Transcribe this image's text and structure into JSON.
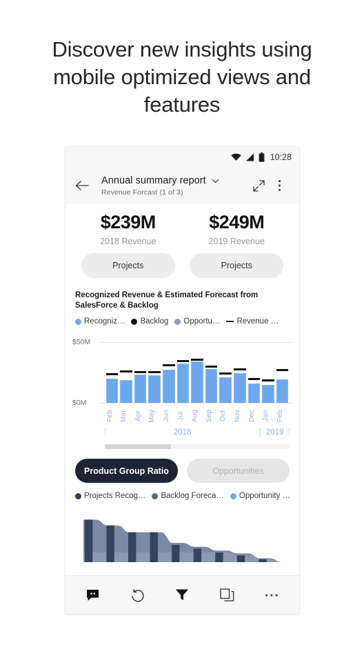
{
  "headline": "Discover new insights using mobile optimized views and features",
  "statusbar": {
    "time": "10:28",
    "icons": [
      "wifi-icon",
      "cellular-signal-icon",
      "battery-icon"
    ]
  },
  "appbar": {
    "back_icon": "back-arrow-icon",
    "title": "Annual summary report",
    "title_chevron_icon": "chevron-down-icon",
    "subtitle": "Revenue Forcast  (1 of 3)",
    "expand_icon": "expand-diagonal-icon",
    "more_icon": "more-vertical-icon"
  },
  "kpis": [
    {
      "value": "$239M",
      "label": "2018 Revenue",
      "button": "Projects"
    },
    {
      "value": "$249M",
      "label": "2019 Revenue",
      "button": "Projects"
    }
  ],
  "chart": {
    "title": "Recognized Revenue & Estimated Forecast from SalesForce & Backlog",
    "legend": [
      {
        "label": "Recogniz…",
        "color": "#6ea8ec",
        "marker": "dot"
      },
      {
        "label": "Backlog",
        "color": "#121212",
        "marker": "dot"
      },
      {
        "label": "Opportu…",
        "color": "#8e9db5",
        "marker": "dot"
      },
      {
        "label": "Revenue …",
        "color": "#1b1b1b",
        "marker": "line"
      }
    ]
  },
  "chart_data": {
    "type": "bar",
    "title": "Recognized Revenue & Estimated Forecast from SalesForce & Backlog",
    "xlabel": "",
    "ylabel": "",
    "ylim": [
      0,
      50
    ],
    "ytick_labels": [
      "$0M",
      "$50M"
    ],
    "grid": "dotted-horizontal",
    "legend_position": "top",
    "categories": [
      "Feb",
      "Mar",
      "Apr",
      "May",
      "Jun",
      "Jul",
      "Aug",
      "Sep",
      "Oct",
      "Nov",
      "Dec",
      "Jan",
      "Feb"
    ],
    "group_labels": [
      {
        "label": "2018",
        "span": 11
      },
      {
        "label": "2019",
        "span": 2
      }
    ],
    "series": [
      {
        "name": "Recognized Revenue",
        "type": "bar",
        "color": "#6ea8ec",
        "values": [
          20.0,
          18.5,
          23.5,
          23.0,
          27.0,
          32.5,
          34.0,
          28.0,
          21.0,
          24.5,
          16.0,
          15.0,
          19.5
        ]
      },
      {
        "name": "Revenue Target",
        "type": "marker-line",
        "color": "#111111",
        "values": [
          22.5,
          25.0,
          24.5,
          24.5,
          30.0,
          33.5,
          34.5,
          29.0,
          23.5,
          26.5,
          18.5,
          17.5,
          26.0
        ]
      }
    ],
    "scrollbar": {
      "thumb_fraction": 0.36,
      "position": "left"
    }
  },
  "toggles": [
    {
      "label": "Product Group Ratio",
      "active": true
    },
    {
      "label": "Opportunities",
      "active": false
    }
  ],
  "legend2": [
    {
      "label": "Projects Recog…",
      "color": "#2f3b56"
    },
    {
      "label": "Backlog Foreca…",
      "color": "#5b6884"
    },
    {
      "label": "Opportunity …",
      "color": "#6ea8ec"
    }
  ],
  "area_chart": {
    "type": "area",
    "colors": {
      "band": "#7b89a4",
      "bars": "#36425e",
      "lower_band": "#8f9cb4"
    },
    "values": [
      44,
      38,
      31,
      31,
      20,
      16,
      12,
      9,
      4
    ],
    "bar_values": [
      44,
      38,
      31,
      31,
      18,
      14,
      10,
      7,
      3
    ]
  },
  "toolbar": [
    {
      "name": "comments-icon",
      "label": "Comments"
    },
    {
      "name": "undo-icon",
      "label": "Reset"
    },
    {
      "name": "filter-icon",
      "label": "Filters"
    },
    {
      "name": "pages-icon",
      "label": "Pages"
    },
    {
      "name": "more-horizontal-icon",
      "label": "More"
    }
  ],
  "colors": {
    "bar_blue": "#6ea8ec",
    "axis_blue": "#8ab4ef",
    "active_pill": "#1d2433",
    "navy": "#2f3b56"
  }
}
